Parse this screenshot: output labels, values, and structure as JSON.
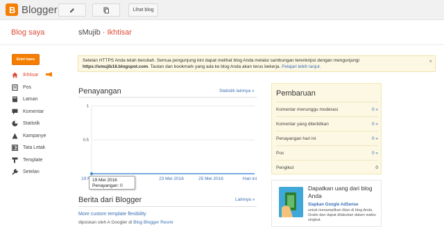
{
  "topbar": {
    "brand": "Blogger",
    "view_blog_label": "Lihat blog"
  },
  "header": {
    "left": "Blog saya",
    "blog_name": "sMujib",
    "separator": "·",
    "page": "Ikhtisar"
  },
  "sidebar": {
    "new_post_label": "Entri baru",
    "items": [
      {
        "label": "Ikhtisar",
        "icon": "home-icon",
        "active": true
      },
      {
        "label": "Pos",
        "icon": "posts-icon"
      },
      {
        "label": "Laman",
        "icon": "pages-icon"
      },
      {
        "label": "Komentar",
        "icon": "comment-icon"
      },
      {
        "label": "Statistik",
        "icon": "stats-icon"
      },
      {
        "label": "Kampanye",
        "icon": "campaign-icon"
      },
      {
        "label": "Tata Letak",
        "icon": "layout-icon"
      },
      {
        "label": "Template",
        "icon": "template-icon"
      },
      {
        "label": "Setelan",
        "icon": "wrench-icon"
      }
    ]
  },
  "notice": {
    "text_1": "Setelan HTTPS Anda telah berubah. Semua pengunjung kini dapat melihat blog Anda melalui sambungan terenkripsi dengan mengunjungi",
    "url": "https://smujib16.blogspot.com",
    "text_2": ". Tautan dan bookmark yang ada ke blog Anda akan terus bekerja.",
    "link": "Pelajari lebih lanjut.",
    "close": "×"
  },
  "views": {
    "title": "Penayangan",
    "more_link": "Statistik lainnya »",
    "tooltip_date": "19 Mei 2016",
    "tooltip_value": "Penayangan: 0"
  },
  "chart_data": {
    "type": "line",
    "x": [
      "19 Mei 2016",
      "23 Mei 2016",
      "25 Mei 2016",
      "Hari ini"
    ],
    "series": [
      {
        "values": [
          0,
          0,
          0,
          0
        ]
      }
    ],
    "y_ticks": [
      "1",
      "0.5"
    ],
    "ylim": [
      0,
      1
    ],
    "grid": true
  },
  "news": {
    "title": "Berita dari Blogger",
    "more_link": "Lainnya »",
    "item_title": "More custom template flexibility",
    "item_meta": "diposkan oleh A Googler di",
    "item_source": "Blog Blogger Resmi"
  },
  "updates": {
    "title": "Pembaruan",
    "rows": [
      {
        "label": "Komentar menunggu moderasi",
        "value": "0 »"
      },
      {
        "label": "Komentar yang diterbitkan",
        "value": "0 »"
      },
      {
        "label": "Penayangan hari ini",
        "value": "0 »"
      },
      {
        "label": "Pos",
        "value": "0 »"
      },
      {
        "label": "Pengikut",
        "value": "0"
      }
    ]
  },
  "ad": {
    "title": "Dapatkan uang dari blog Anda",
    "subtitle": "Siapkan Google AdSense",
    "desc": "untuk menampilkan iklan di blog Anda. Gratis dan dapat dilakukan dalam waktu singkat."
  },
  "colors": {
    "accent": "#f57d00",
    "link": "#3a6fb5",
    "header": "#dd4b39"
  }
}
